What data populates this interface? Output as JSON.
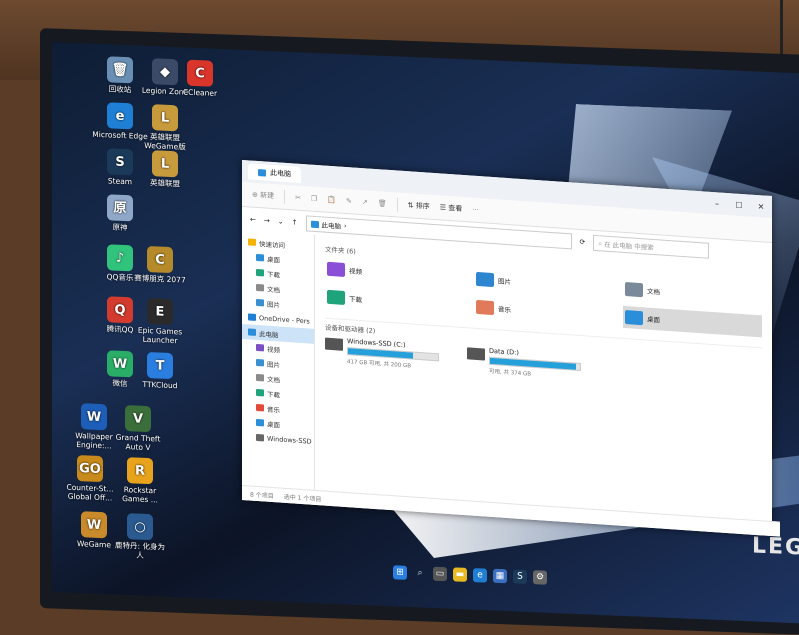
{
  "desktop": {
    "brand": "LEG",
    "icons": [
      {
        "label": "回收站",
        "icon": "recycle-bin-icon",
        "color": "#6a8fb5",
        "glyph": "🗑"
      },
      {
        "label": "Legion Zone",
        "icon": "legion-zone-icon",
        "color": "#3b4a66",
        "glyph": "◆"
      },
      {
        "label": "CCleaner",
        "icon": "ccleaner-icon",
        "color": "#d9352a",
        "glyph": "C"
      },
      {
        "label": "Microsoft Edge",
        "icon": "edge-icon",
        "color": "#1f7fd4",
        "glyph": "e"
      },
      {
        "label": "英雄联盟 WeGame版",
        "icon": "lol-wegame-icon",
        "color": "#c79a3c",
        "glyph": "L"
      },
      {
        "label": "Steam",
        "icon": "steam-icon",
        "color": "#1b3a5a",
        "glyph": "S"
      },
      {
        "label": "英雄联盟",
        "icon": "lol-icon",
        "color": "#c79a3c",
        "glyph": "L"
      },
      {
        "label": "原神",
        "icon": "genshin-icon",
        "color": "#8fa7c8",
        "glyph": "原"
      },
      {
        "label": "QQ音乐",
        "icon": "qq-music-icon",
        "color": "#31c27c",
        "glyph": "♪"
      },
      {
        "label": "赛博朋克 2077",
        "icon": "cyberpunk-icon",
        "color": "#b48a2a",
        "glyph": "C"
      },
      {
        "label": "腾讯QQ",
        "icon": "qq-icon",
        "color": "#d23b2d",
        "glyph": "Q"
      },
      {
        "label": "Epic Games Launcher",
        "icon": "epic-icon",
        "color": "#2a2a2a",
        "glyph": "E"
      },
      {
        "label": "微信",
        "icon": "wechat-icon",
        "color": "#2aae67",
        "glyph": "W"
      },
      {
        "label": "TTKCloud",
        "icon": "ttkcloud-icon",
        "color": "#2a7ee0",
        "glyph": "T"
      },
      {
        "label": "Wallpaper Engine:...",
        "icon": "wallpaper-engine-icon",
        "color": "#1d5fb8",
        "glyph": "W"
      },
      {
        "label": "Grand Theft Auto V",
        "icon": "gta-icon",
        "color": "#3a6e3a",
        "glyph": "V"
      },
      {
        "label": "Counter-St... Global Off...",
        "icon": "csgo-icon",
        "color": "#c88a1a",
        "glyph": "GO"
      },
      {
        "label": "Rockstar Games ...",
        "icon": "rockstar-icon",
        "color": "#e8a31c",
        "glyph": "R"
      },
      {
        "label": "WeGame",
        "icon": "wegame-icon",
        "color": "#c88a2a",
        "glyph": "W"
      },
      {
        "label": "鹿特丹: 化身为人",
        "icon": "game-ring-icon",
        "color": "#2a5a90",
        "glyph": "○"
      }
    ]
  },
  "window": {
    "title": "此电脑",
    "address": "此电脑",
    "search_placeholder": "在 此电脑 中搜索",
    "cmd": {
      "new": "新建",
      "sort": "排序",
      "view": "查看",
      "more": "···"
    },
    "nav": [
      {
        "label": "快速访问",
        "icon": "star-icon",
        "color": "#f3b300"
      },
      {
        "label": "桌面",
        "icon": "desktop-icon",
        "color": "#2a8fd8"
      },
      {
        "label": "下载",
        "icon": "download-icon",
        "color": "#1fa37a"
      },
      {
        "label": "文档",
        "icon": "document-icon",
        "color": "#8a8a8a"
      },
      {
        "label": "图片",
        "icon": "picture-icon",
        "color": "#3a8fd0"
      },
      {
        "label": "OneDrive - Pers",
        "icon": "onedrive-icon",
        "color": "#1f7fd4"
      },
      {
        "label": "此电脑",
        "icon": "this-pc-icon",
        "color": "#2a8fd8"
      },
      {
        "label": "视频",
        "icon": "video-icon",
        "color": "#7b4ec2"
      },
      {
        "label": "图片",
        "icon": "picture-icon",
        "color": "#3a8fd0"
      },
      {
        "label": "文档",
        "icon": "document-icon",
        "color": "#8a8a8a"
      },
      {
        "label": "下载",
        "icon": "download-icon",
        "color": "#1fa37a"
      },
      {
        "label": "音乐",
        "icon": "music-icon",
        "color": "#e04a3a"
      },
      {
        "label": "桌面",
        "icon": "desktop-icon",
        "color": "#2a8fd8"
      },
      {
        "label": "Windows-SSD",
        "icon": "drive-icon",
        "color": "#666666"
      }
    ],
    "folders_header": "文件夹 (6)",
    "folders": [
      {
        "label": "视频",
        "icon": "video-folder-icon",
        "color": "#8a4fd6"
      },
      {
        "label": "图片",
        "icon": "picture-folder-icon",
        "color": "#2f86d0"
      },
      {
        "label": "文档",
        "icon": "document-folder-icon",
        "color": "#7a8a9a"
      },
      {
        "label": "下载",
        "icon": "download-folder-icon",
        "color": "#1fa37a"
      },
      {
        "label": "音乐",
        "icon": "music-folder-icon",
        "color": "#e07a5a"
      },
      {
        "label": "桌面",
        "icon": "desktop-folder-icon",
        "color": "#2a8fd8"
      }
    ],
    "drives_header": "设备和驱动器 (2)",
    "drives": [
      {
        "label": "Windows-SSD (C:)",
        "free": "417 GB 可用, 共 200 GB",
        "used": 0.72
      },
      {
        "label": "Data (D:)",
        "free": "可用, 共 374 GB",
        "used": 0.95
      }
    ],
    "status_items": "8 个项目",
    "status_selected": "选中 1 个项目"
  }
}
